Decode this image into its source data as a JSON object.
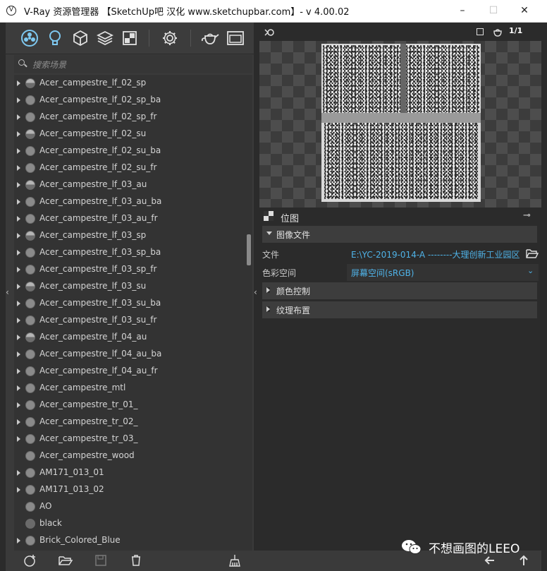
{
  "window": {
    "title": "V-Ray 资源管理器 【SketchUp吧 汉化 www.sketchupbar.com】- v 4.00.02",
    "minimize": "–",
    "maximize": "☐",
    "close": "✕"
  },
  "toolbar": {
    "icons": [
      "materials-icon",
      "lights-icon",
      "geometry-icon",
      "layers-icon",
      "textures-icon",
      "settings-icon",
      "render-teapot-icon",
      "frame-buffer-icon"
    ]
  },
  "search": {
    "placeholder": "搜索场景"
  },
  "materials": [
    {
      "name": "Acer_campestre_lf_02_sp",
      "shade": "half"
    },
    {
      "name": "Acer_campestre_lf_02_sp_ba",
      "shade": "plain"
    },
    {
      "name": "Acer_campestre_lf_02_sp_fr",
      "shade": "plain"
    },
    {
      "name": "Acer_campestre_lf_02_su",
      "shade": "half"
    },
    {
      "name": "Acer_campestre_lf_02_su_ba",
      "shade": "plain"
    },
    {
      "name": "Acer_campestre_lf_02_su_fr",
      "shade": "plain"
    },
    {
      "name": "Acer_campestre_lf_03_au",
      "shade": "half"
    },
    {
      "name": "Acer_campestre_lf_03_au_ba",
      "shade": "plain"
    },
    {
      "name": "Acer_campestre_lf_03_au_fr",
      "shade": "plain"
    },
    {
      "name": "Acer_campestre_lf_03_sp",
      "shade": "half"
    },
    {
      "name": "Acer_campestre_lf_03_sp_ba",
      "shade": "plain"
    },
    {
      "name": "Acer_campestre_lf_03_sp_fr",
      "shade": "plain"
    },
    {
      "name": "Acer_campestre_lf_03_su",
      "shade": "half"
    },
    {
      "name": "Acer_campestre_lf_03_su_ba",
      "shade": "plain"
    },
    {
      "name": "Acer_campestre_lf_03_su_fr",
      "shade": "plain"
    },
    {
      "name": "Acer_campestre_lf_04_au",
      "shade": "half"
    },
    {
      "name": "Acer_campestre_lf_04_au_ba",
      "shade": "plain"
    },
    {
      "name": "Acer_campestre_lf_04_au_fr",
      "shade": "plain"
    },
    {
      "name": "Acer_campestre_mtl",
      "shade": "plain"
    },
    {
      "name": "Acer_campestre_tr_01_",
      "shade": "plain"
    },
    {
      "name": "Acer_campestre_tr_02_",
      "shade": "plain"
    },
    {
      "name": "Acer_campestre_tr_03_",
      "shade": "plain"
    },
    {
      "name": "Acer_campestre_wood",
      "shade": "plain"
    },
    {
      "name": "AM171_013_01",
      "shade": "plain"
    },
    {
      "name": "AM171_013_02",
      "shade": "plain"
    },
    {
      "name": "AO",
      "shade": "plain"
    },
    {
      "name": "black",
      "shade": "dark"
    },
    {
      "name": "Brick_Colored_Blue",
      "shade": "plain"
    }
  ],
  "preview": {
    "page_indicator": "1/1"
  },
  "properties": {
    "node_title": "位图",
    "image_file_section": "图像文件",
    "file_label": "文件",
    "file_value": "E:\\YC-2019-014-A --------大理创新工业园区...",
    "colorspace_label": "色彩空间",
    "colorspace_value": "屏幕空间(sRGB)",
    "color_control_section": "颜色控制",
    "texture_placement_section": "纹理布置"
  },
  "watermark": {
    "text": "不想画图的LEEO"
  },
  "colors": {
    "accent": "#4fb3e8",
    "panel": "#3a3a3a",
    "background": "#2b2b2b"
  }
}
